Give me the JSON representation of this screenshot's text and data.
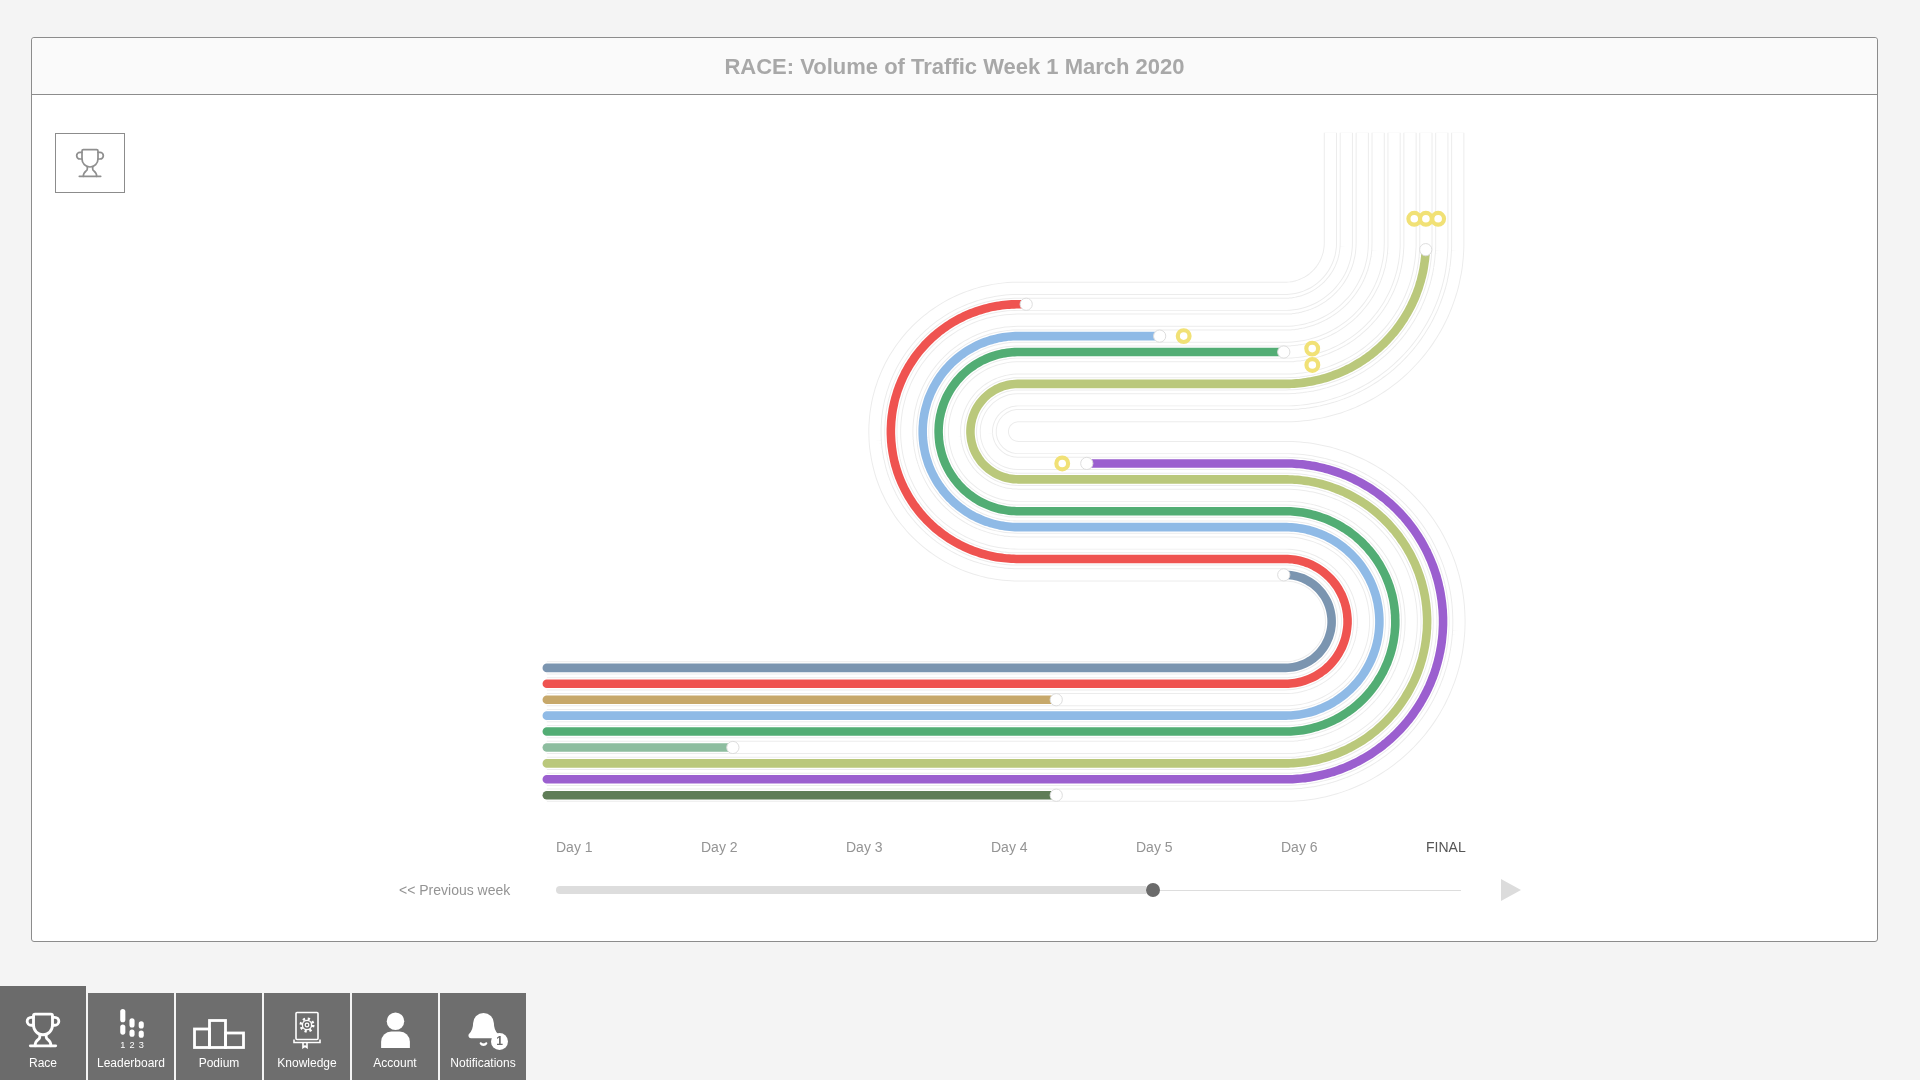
{
  "header": {
    "title": "RACE: Volume of Traffic Week 1 March 2020"
  },
  "race": {
    "lanes": [
      {
        "color": "#7b95b0"
      },
      {
        "color": "#ef5350"
      },
      {
        "color": "#c7a86a"
      },
      {
        "color": "#8fbae6"
      },
      {
        "color": "#52ad74"
      },
      {
        "color": "#8dbd9f"
      },
      {
        "color": "#bac87b"
      },
      {
        "color": "#9b5fcf"
      },
      {
        "color": "#5f7d57"
      }
    ]
  },
  "timeline": {
    "days": [
      {
        "label": "Day 1",
        "kind": "day"
      },
      {
        "label": "Day 2",
        "kind": "day"
      },
      {
        "label": "Day 3",
        "kind": "day"
      },
      {
        "label": "Day 4",
        "kind": "day"
      },
      {
        "label": "Day 5",
        "kind": "day"
      },
      {
        "label": "Day 6",
        "kind": "day"
      },
      {
        "label": "FINAL",
        "kind": "final"
      }
    ],
    "previous_week": "<< Previous week",
    "level": 0.66
  },
  "nav": [
    {
      "label": "Race",
      "kind": "race",
      "selected": true
    },
    {
      "label": "Leaderboard",
      "kind": "leaderboard",
      "selected": false,
      "icon_digits": [
        "1",
        "2",
        "3"
      ]
    },
    {
      "label": "Podium",
      "kind": "podium",
      "selected": false
    },
    {
      "label": "Knowledge",
      "kind": "knowledge",
      "selected": false
    },
    {
      "label": "Account",
      "kind": "account",
      "selected": false
    },
    {
      "label": "Notifications",
      "kind": "notifications",
      "selected": false,
      "badge": "1"
    }
  ]
}
